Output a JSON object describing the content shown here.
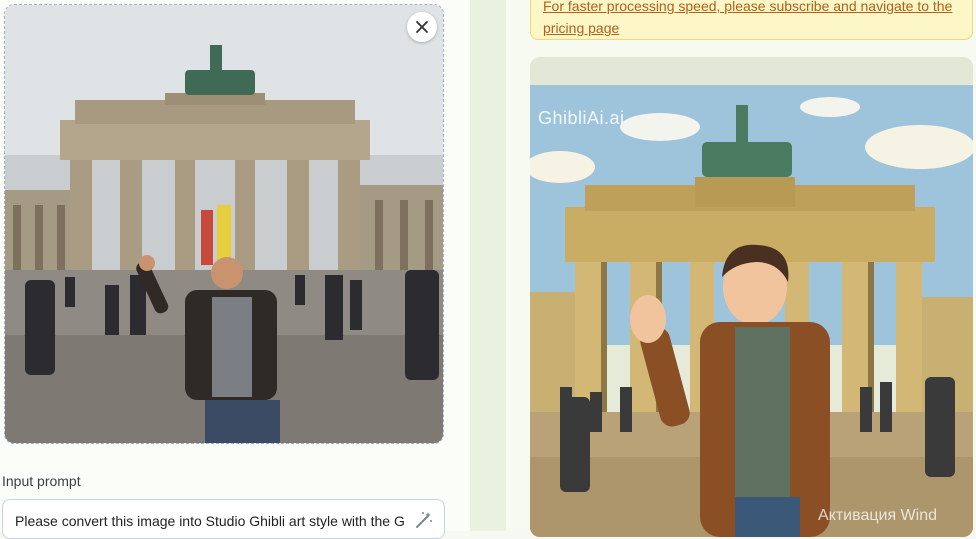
{
  "notice": {
    "text": "For faster processing speed, please subscribe and navigate to the pricing page"
  },
  "prompt": {
    "label": "Input prompt",
    "value": "Please convert this image into Studio Ghibli art style with the G"
  },
  "result": {
    "watermark": "GhibliAi.ai"
  },
  "os": {
    "activation_text": "Активация Wind"
  },
  "icons": {
    "close": "close-icon",
    "wand": "magic-wand-icon"
  },
  "colors": {
    "notice_bg": "#fdf6c6",
    "notice_text": "#b0611c",
    "divider": "#e9f2df"
  }
}
